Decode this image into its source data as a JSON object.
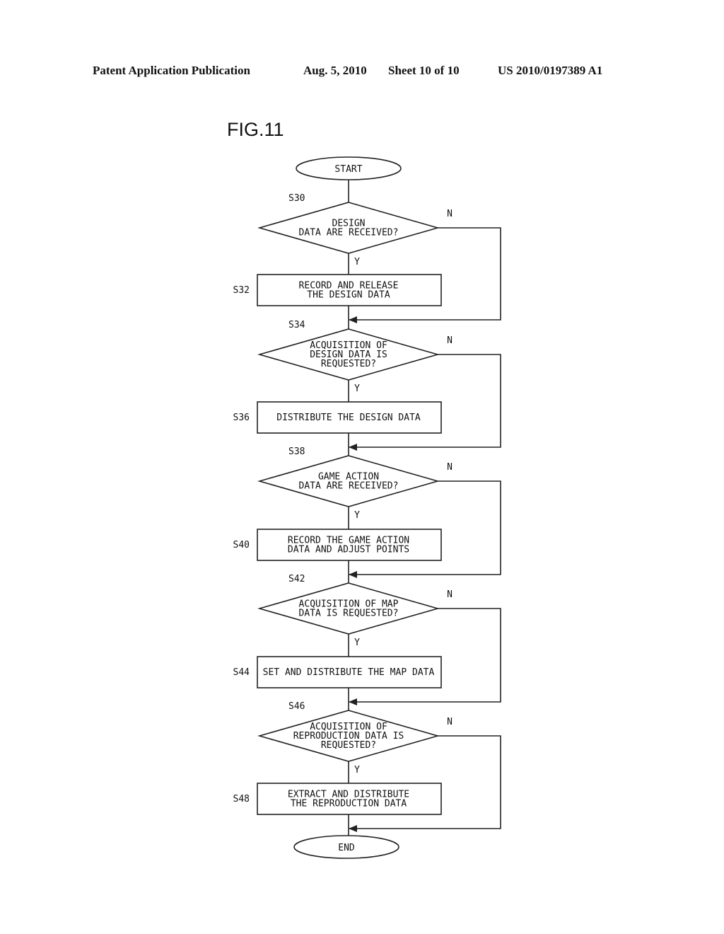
{
  "header": {
    "publication": "Patent Application Publication",
    "date": "Aug. 5, 2010",
    "sheet": "Sheet 10 of 10",
    "number": "US 2010/0197389 A1"
  },
  "figure": {
    "title": "FIG.11",
    "start_label": "START",
    "end_label": "END",
    "yes_label": "Y",
    "no_label": "N",
    "steps": [
      {
        "id": "S30",
        "type": "decision",
        "lines": [
          "DESIGN",
          "DATA ARE RECEIVED?"
        ]
      },
      {
        "id": "S32",
        "type": "process",
        "lines": [
          "RECORD AND RELEASE",
          "THE DESIGN DATA"
        ]
      },
      {
        "id": "S34",
        "type": "decision",
        "lines": [
          "ACQUISITION OF",
          "DESIGN DATA IS",
          "REQUESTED?"
        ]
      },
      {
        "id": "S36",
        "type": "process",
        "lines": [
          "DISTRIBUTE THE DESIGN DATA"
        ]
      },
      {
        "id": "S38",
        "type": "decision",
        "lines": [
          "GAME ACTION",
          "DATA ARE RECEIVED?"
        ]
      },
      {
        "id": "S40",
        "type": "process",
        "lines": [
          "RECORD THE GAME ACTION",
          "DATA AND ADJUST POINTS"
        ]
      },
      {
        "id": "S42",
        "type": "decision",
        "lines": [
          "ACQUISITION OF MAP",
          "DATA IS REQUESTED?"
        ]
      },
      {
        "id": "S44",
        "type": "process",
        "lines": [
          "SET AND DISTRIBUTE THE MAP DATA"
        ]
      },
      {
        "id": "S46",
        "type": "decision",
        "lines": [
          "ACQUISITION OF",
          "REPRODUCTION DATA IS",
          "REQUESTED?"
        ]
      },
      {
        "id": "S48",
        "type": "process",
        "lines": [
          "EXTRACT AND DISTRIBUTE",
          "THE REPRODUCTION DATA"
        ]
      }
    ]
  }
}
